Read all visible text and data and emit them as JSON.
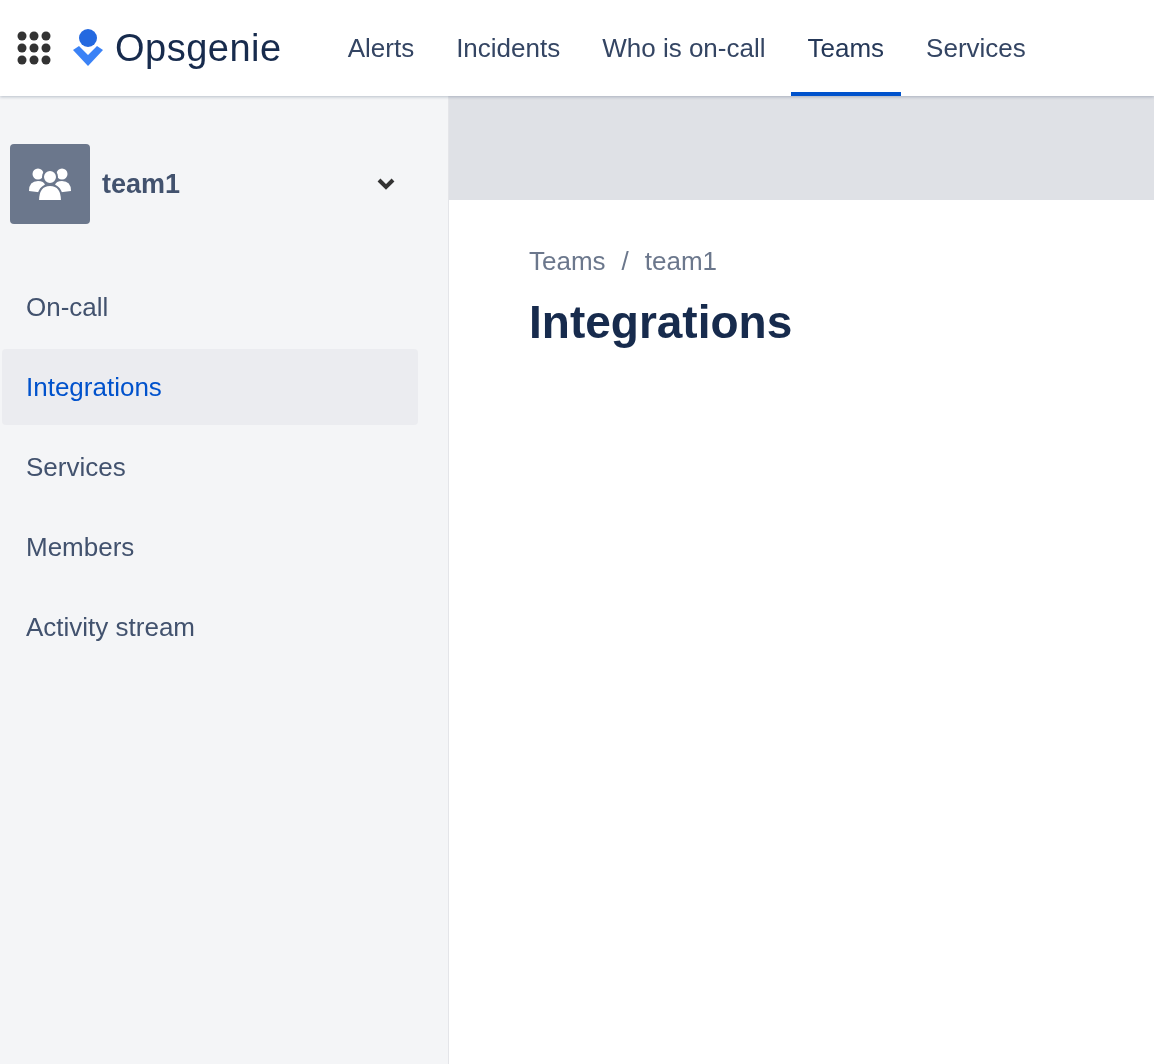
{
  "header": {
    "product": "Opsgenie",
    "nav": [
      {
        "label": "Alerts",
        "selected": false
      },
      {
        "label": "Incidents",
        "selected": false
      },
      {
        "label": "Who is on-call",
        "selected": false
      },
      {
        "label": "Teams",
        "selected": true
      },
      {
        "label": "Services",
        "selected": false
      }
    ]
  },
  "sidebar": {
    "team": "team1",
    "items": [
      {
        "label": "On-call",
        "selected": false
      },
      {
        "label": "Integrations",
        "selected": true
      },
      {
        "label": "Services",
        "selected": false
      },
      {
        "label": "Members",
        "selected": false
      },
      {
        "label": "Activity stream",
        "selected": false
      }
    ]
  },
  "main": {
    "breadcrumbs": [
      "Teams",
      "team1"
    ],
    "breadcrumb_separator": "/",
    "title": "Integrations"
  }
}
